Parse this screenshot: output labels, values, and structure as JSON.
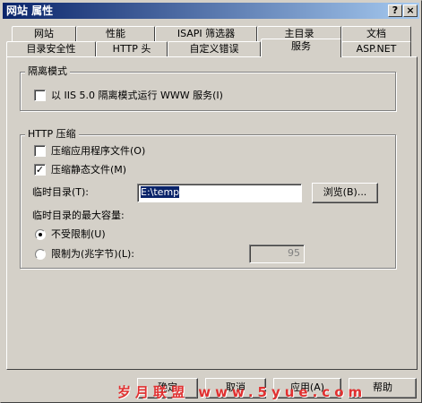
{
  "window": {
    "title": "网站 属性",
    "help_button": "?",
    "close_button": "×"
  },
  "tabs_row1": [
    "网站",
    "性能",
    "ISAPI 筛选器",
    "主目录",
    "文档"
  ],
  "tabs_row2": [
    "目录安全性",
    "HTTP 头",
    "自定义错误",
    "服务",
    "ASP.NET"
  ],
  "isolation": {
    "legend": "隔离模式",
    "checkbox_label": "以 IIS 5.0 隔离模式运行 WWW 服务(I)",
    "checked": false
  },
  "compression": {
    "legend": "HTTP 压缩",
    "compress_app_label": "压缩应用程序文件(O)",
    "compress_app_checked": false,
    "compress_static_label": "压缩静态文件(M)",
    "compress_static_checked": true,
    "temp_dir_label": "临时目录(T):",
    "temp_dir_value": "E:\\temp",
    "browse_button": "浏览(B)...",
    "max_size_label": "临时目录的最大容量:",
    "unlimited_label": "不受限制(U)",
    "unlimited_selected": true,
    "limit_label": "限制为(兆字节)(L):",
    "limit_value": "95"
  },
  "buttons": {
    "ok": "确定",
    "cancel": "取消",
    "apply": "应用(A)",
    "help": "帮助"
  },
  "watermark": "岁月联盟 www.5yue.com"
}
